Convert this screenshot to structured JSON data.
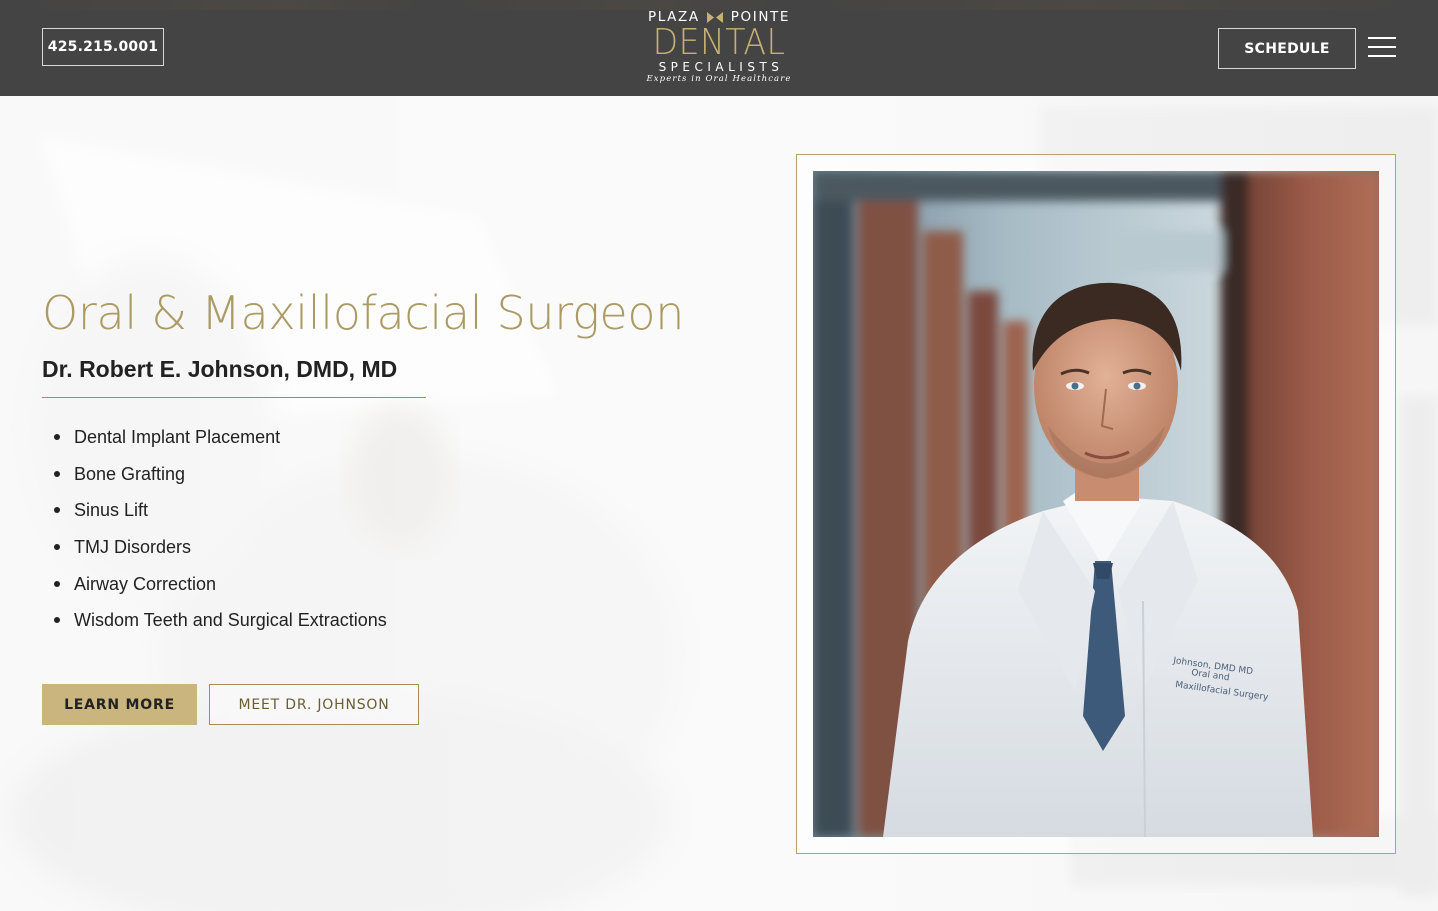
{
  "header": {
    "phone": "425.215.0001",
    "schedule_label": "SCHEDULE",
    "logo": {
      "top_left": "PLAZA",
      "top_right": "POINTE",
      "main": "DENTAL",
      "sub": "SPECIALISTS",
      "tagline": "Experts in Oral Healthcare"
    }
  },
  "hero": {
    "title": "Oral & Maxillofacial Surgeon",
    "doctor_name": "Dr. Robert E. Johnson, DMD, MD",
    "services": [
      "Dental Implant Placement",
      "Bone Grafting",
      "Sinus Lift",
      "TMJ Disorders",
      "Airway Correction",
      "Wisdom Teeth and Surgical Extractions"
    ],
    "learn_more_label": "LEARN MORE",
    "meet_label": "MEET DR. JOHNSON"
  },
  "colors": {
    "header_bg": "#444444",
    "gold": "#ab9a63",
    "gold_button": "#c9b57d"
  }
}
